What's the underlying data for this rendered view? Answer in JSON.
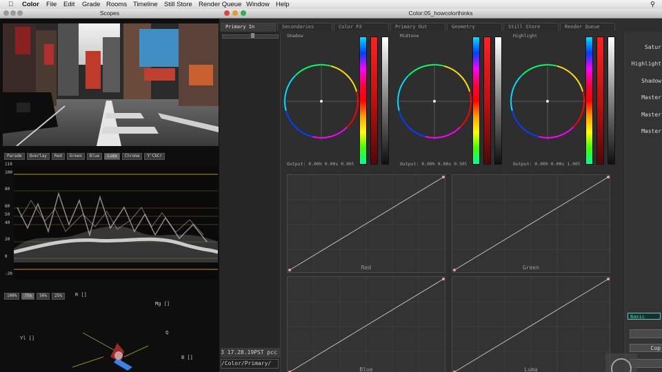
{
  "menubar": {
    "app": "Color",
    "items": [
      "File",
      "Edit",
      "Grade",
      "Rooms",
      "Timeline",
      "Still Store",
      "Render Queue",
      "Window",
      "Help"
    ]
  },
  "scopes": {
    "title": "Scopes",
    "waveform_buttons": [
      "Parade",
      "Overlay",
      "Red",
      "Green",
      "Blue",
      "Luma",
      "Chroma",
      "Y'CbCr"
    ],
    "waveform_selected": "Luma",
    "scale": [
      "110",
      "100",
      "80",
      "60",
      "50",
      "40",
      "20",
      "0",
      "-20"
    ],
    "vector_buttons": [
      "100%",
      "75%",
      "50%",
      "25%"
    ],
    "vector_selected": "75%",
    "vector_labels": {
      "r": "R []",
      "mg": "Mg []",
      "q": "Q",
      "yl": "Yl []",
      "b": "B []"
    }
  },
  "color_window": {
    "title": "Color:05_howcolorthinks",
    "tabs": [
      "Primary In",
      "Secondaries",
      "Color FX",
      "Primary Out",
      "Geometry",
      "Still Store",
      "Render Queue"
    ],
    "active_tab": "Primary In",
    "wheels": [
      {
        "name": "Shadow",
        "output": "Output: 0.00h 0.00s 0.00l"
      },
      {
        "name": "Midtone",
        "output": "Output: 0.00h 0.00s 0.50l"
      },
      {
        "name": "Highlight",
        "output": "Output: 0.00h 0.00s 1.00l"
      }
    ],
    "curves": [
      "Red",
      "Green",
      "Blue",
      "Luma"
    ],
    "right_labels": [
      "Satur",
      "Highlight",
      "Shadow",
      "Master",
      "Master",
      "Master"
    ],
    "basic_tab": "Basic",
    "cop_button": "Cop",
    "timestamp": "3 17.28.19PST pcc",
    "path": "/Color/Primary/"
  },
  "colors": {
    "accent_orange": "#c8901e",
    "panel": "#2e2e2e"
  }
}
